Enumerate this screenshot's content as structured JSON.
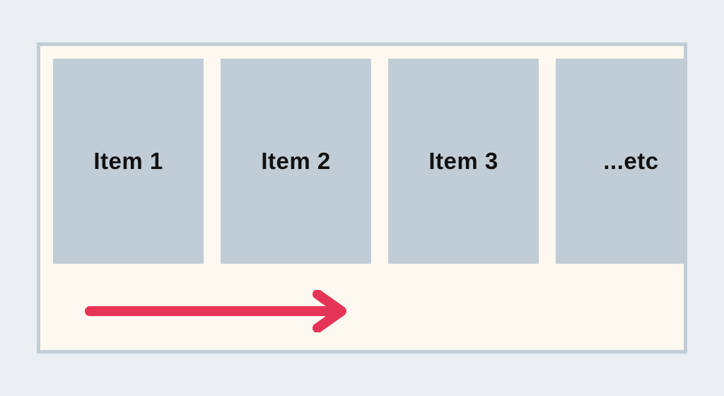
{
  "carousel": {
    "items": [
      {
        "label": "Item 1"
      },
      {
        "label": "Item 2"
      },
      {
        "label": "Item 3"
      },
      {
        "label": "...etc"
      }
    ]
  },
  "arrow": {
    "color": "#e63457",
    "direction": "right"
  }
}
